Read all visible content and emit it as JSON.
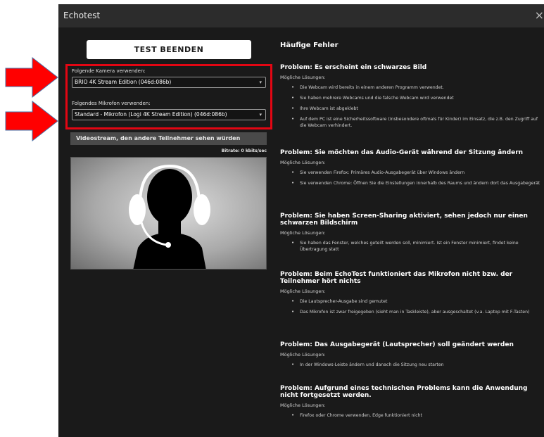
{
  "window": {
    "title": "Echotest",
    "close_glyph": "×"
  },
  "left": {
    "test_button": "TEST BEENDEN",
    "camera_label": "Folgende Kamera verwenden:",
    "camera_value": "BRIO 4K Stream Edition (046d:086b)",
    "mic_label": "Folgendes Mikrofon verwenden:",
    "mic_value": "Standard - Mikrofon (Logi 4K Stream Edition) (046d:086b)",
    "video_header": "Videostream, den andere Teilnehmer sehen würden",
    "bitrate": "Bitrate: 0 kbits/sec"
  },
  "right": {
    "heading": "Häufige Fehler",
    "sub_label": "Mögliche Lösungen:",
    "problems": [
      {
        "title": "Problem: Es erscheint ein schwarzes Bild",
        "items": [
          "Die Webcam wird bereits in einem anderen Programm verwendet.",
          "Sie haben mehrere Webcams und die falsche Webcam wird verwendet",
          "Ihre Webcam ist abgeklebt",
          "Auf dem PC ist eine Sicherheitssoftware (insbesondere oftmals für Kinder) im Einsatz, die z.B. den Zugriff auf die Webcam verhindert."
        ]
      },
      {
        "title": "Problem: Sie möchten das Audio-Gerät während der Sitzung ändern",
        "items": [
          "Sie verwenden Firefox: Primäres Audio-Ausgabegerät über Windows ändern",
          "Sie verwenden Chrome: Öffnen Sie die Einstellungen innerhalb des Raums und ändern dort das Ausgabegerät"
        ]
      },
      {
        "title": "Problem: Sie haben Screen-Sharing aktiviert, sehen jedoch nur einen schwarzen Bildschirm",
        "items": [
          "Sie haben das Fenster, welches geteilt werden soll, minimiert. Ist ein Fenster minimiert, findet keine Übertragung statt"
        ]
      },
      {
        "title": "Problem: Beim EchoTest funktioniert das Mikrofon nicht bzw. der Teilnehmer hört nichts",
        "items": [
          "Die Lautsprecher-Ausgabe sind gemutet",
          "Das Mikrofon ist zwar freigegeben (sieht man in Taskleiste), aber ausgeschaltet (v.a. Laptop mit F-Tasten)"
        ]
      },
      {
        "title": "Problem: Das Ausgabegerät (Lautsprecher) soll geändert werden",
        "items": [
          "In der Windows-Leiste ändern und danach die Sitzung neu starten"
        ]
      },
      {
        "title": "Problem: Aufgrund eines technischen Problems kann die Anwendung nicht fortgesetzt werden.",
        "items": [
          "Firefox oder Chrome verwenden, Edge funktioniert nicht"
        ]
      }
    ]
  },
  "colors": {
    "annotation_red": "#e30613",
    "dialog_bg": "#1a1a1a",
    "titlebar_bg": "#2c2c2c"
  }
}
